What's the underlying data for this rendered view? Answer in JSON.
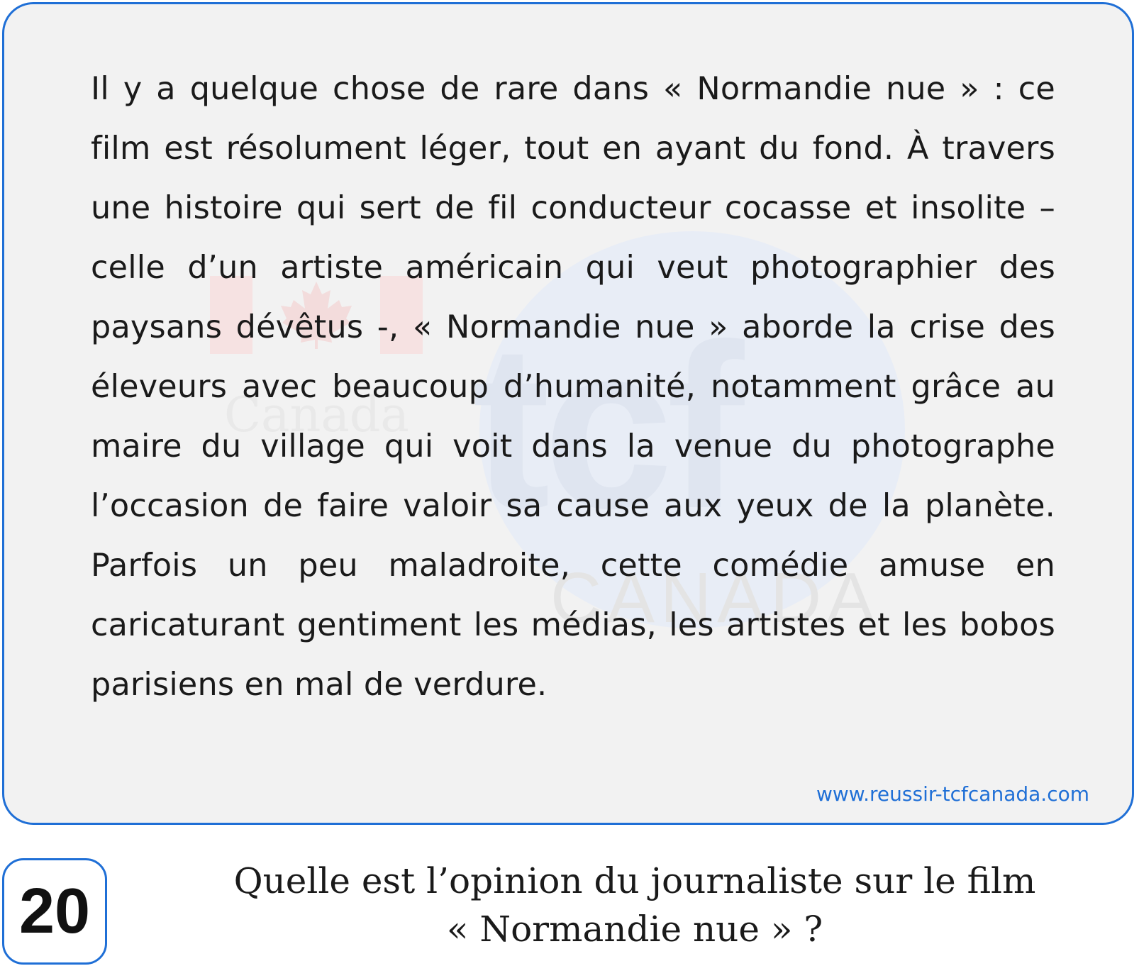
{
  "passage": {
    "text": "Il y a quelque chose de rare dans « Normandie nue » : ce film est résolument léger, tout en ayant du fond. À travers une histoire qui sert de fil conducteur cocasse et insolite – celle d’un artiste américain qui veut photographier des paysans dévêtus -, « Normandie nue » aborde la crise des éleveurs avec beaucoup d’humanité, notamment grâce au maire du village qui voit dans la venue du photographe l’occasion de faire valoir sa cause aux yeux de la planète. Parfois un peu maladroite, cette comédie amuse en caricaturant gentiment les médias, les artistes et les bobos parisiens en mal de verdure."
  },
  "website": "www.reussir-tcfcanada.com",
  "watermark": {
    "small_text": "Canada",
    "logo_text": "tcf",
    "big_text": "CANADA"
  },
  "question": {
    "number": "20",
    "line1": "Quelle est l’opinion du journaliste sur le film",
    "line2": "« Normandie nue » ?"
  },
  "colors": {
    "accent": "#1f6fd6",
    "card_background": "#f2f2f2",
    "text": "#1a1a1a"
  }
}
